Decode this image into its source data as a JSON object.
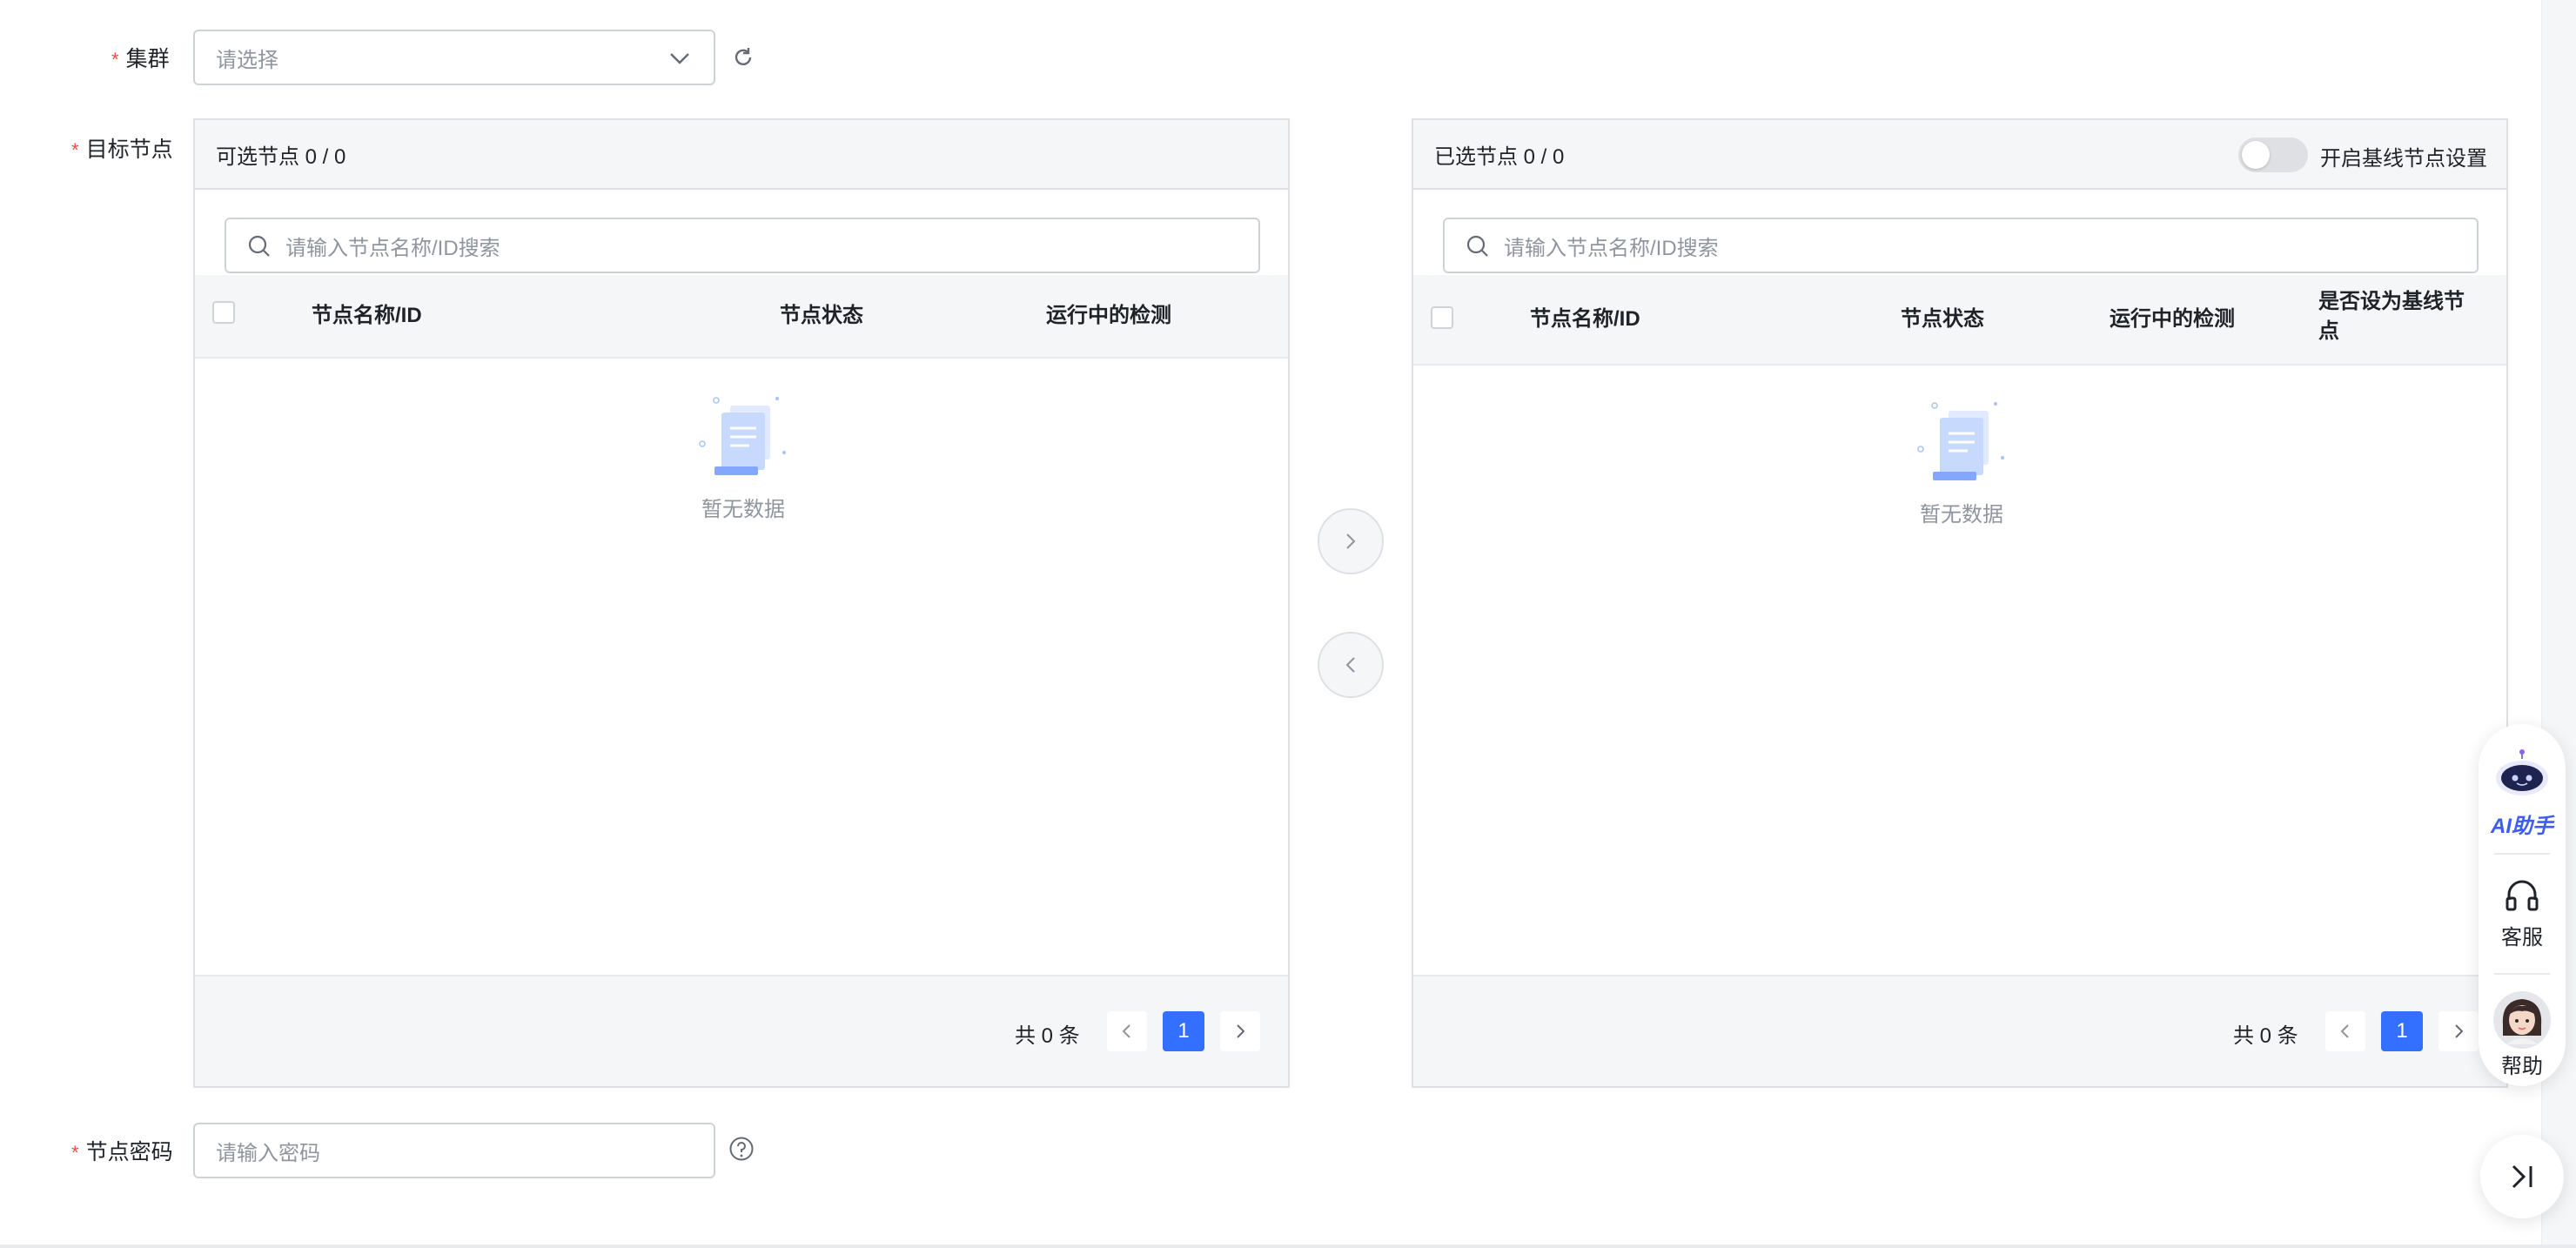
{
  "form": {
    "cluster": {
      "label": "集群",
      "placeholder": "请选择"
    },
    "target_nodes": {
      "label": "目标节点"
    },
    "node_password": {
      "label": "节点密码",
      "placeholder": "请输入密码"
    }
  },
  "available_panel": {
    "title": "可选节点 0 / 0",
    "search_placeholder": "请输入节点名称/ID搜索",
    "columns": [
      "节点名称/ID",
      "节点状态",
      "运行中的检测"
    ],
    "empty_text": "暂无数据",
    "total_text": "共 0 条",
    "current_page": "1"
  },
  "selected_panel": {
    "title": "已选节点 0 / 0",
    "baseline_toggle_label": "开启基线节点设置",
    "search_placeholder": "请输入节点名称/ID搜索",
    "columns": [
      "节点名称/ID",
      "节点状态",
      "运行中的检测",
      "是否设为基线节点"
    ],
    "empty_text": "暂无数据",
    "total_text": "共 0 条",
    "current_page": "1"
  },
  "float_toolbar": {
    "ai_label": "AI助手",
    "service_label": "客服",
    "help_label": "帮助"
  },
  "colors": {
    "primary": "#3370ff",
    "required": "#f54a45",
    "border": "#dee0e3",
    "header_bg": "#f5f6f7"
  }
}
